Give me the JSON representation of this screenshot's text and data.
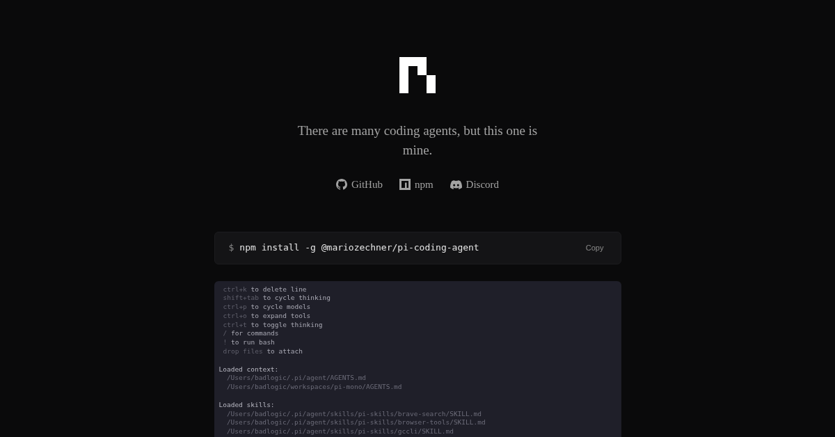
{
  "tagline": "There are many coding agents, but this one is mine.",
  "links": [
    {
      "kind": "github",
      "label": "GitHub"
    },
    {
      "kind": "npm",
      "label": "npm"
    },
    {
      "kind": "discord",
      "label": "Discord"
    }
  ],
  "install": {
    "prompt": "$",
    "command": "npm install -g @mariozechner/pi-coding-agent",
    "copy": "Copy"
  },
  "terminal": {
    "hints": [
      {
        "key": "ctrl+k",
        "text": "to delete line"
      },
      {
        "key": "shift+tab",
        "text": "to cycle thinking"
      },
      {
        "key": "ctrl+p",
        "text": "to cycle models"
      },
      {
        "key": "ctrl+o",
        "text": "to expand tools"
      },
      {
        "key": "ctrl+t",
        "text": "to toggle thinking"
      },
      {
        "key": "/",
        "text": "for commands"
      },
      {
        "key": "!",
        "text": "to run bash"
      },
      {
        "key": "drop files",
        "text": "to attach"
      }
    ],
    "sections": [
      {
        "heading": "Loaded context:",
        "items": [
          "/Users/badlogic/.pi/agent/AGENTS.md",
          "/Users/badlogic/workspaces/pi-mono/AGENTS.md"
        ]
      },
      {
        "heading": "Loaded skills:",
        "items": [
          "/Users/badlogic/.pi/agent/skills/pi-skills/brave-search/SKILL.md",
          "/Users/badlogic/.pi/agent/skills/pi-skills/browser-tools/SKILL.md",
          "/Users/badlogic/.pi/agent/skills/pi-skills/gccli/SKILL.md"
        ]
      }
    ]
  }
}
